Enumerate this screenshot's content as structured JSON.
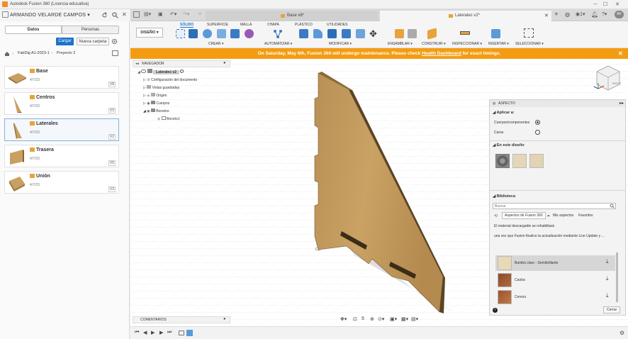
{
  "window": {
    "title": "Autodesk Fusion 360 (Licencia educativa)"
  },
  "left": {
    "user": "ARMANDO VELARDE CAMPOS",
    "tabs": [
      "Datos",
      "Personas"
    ],
    "buttons": {
      "upload": "Cargar",
      "new_folder": "Nueva carpeta"
    },
    "breadcrumb": [
      "FabDig A1-2023-1",
      "Proyecto 2"
    ],
    "files": [
      {
        "name": "Base",
        "date": "4/7/23",
        "version": "V8"
      },
      {
        "name": "Centros",
        "date": "4/7/23",
        "version": "V3"
      },
      {
        "name": "Laterales",
        "date": "4/7/23",
        "version": "V2"
      },
      {
        "name": "Trasera",
        "date": "4/7/23",
        "version": "V5"
      },
      {
        "name": "Unión",
        "date": "4/7/23",
        "version": "V3"
      }
    ]
  },
  "doc_tabs": [
    {
      "label": "Base v8*"
    },
    {
      "label": "Laterales v2*"
    }
  ],
  "toolbar": {
    "workspace": "DISEÑO",
    "tabs": [
      "SÓLIDO",
      "SUPERFICIE",
      "MALLA",
      "CHAPA",
      "PLÁSTICO",
      "UTILIDADES"
    ],
    "groups": [
      "CREAR",
      "AUTOMATIZAR",
      "MODIFICAR",
      "ENSAMBLAR",
      "CONSTRUIR",
      "INSPECCIONAR",
      "INSERTAR",
      "SELECCIONAR"
    ]
  },
  "banner": {
    "text_before": "On Saturday, May 6th, Fusion 360 will undergo maintenance. Please check",
    "link": "Health Dashboard",
    "text_after": "for exact timings."
  },
  "navigator": {
    "title": "NAVEGADOR",
    "root": "Laterales v2",
    "items": [
      "Configuración del documento",
      "Vistas guardadas",
      "Origen",
      "Cuerpos",
      "Bocetos",
      "Boceto1"
    ]
  },
  "comments": {
    "title": "COMENTARIOS"
  },
  "aspecto": {
    "title": "ASPECTO",
    "apply_label": "Aplicar a:",
    "option1": "Cuerpos/componentes",
    "option2": "Caras",
    "design_label": "En este diseño",
    "library_label": "Biblioteca",
    "search_placeholder": "Buscar",
    "lib_tabs": [
      "Aspectos de Fusion 360",
      "Mis aspectos",
      "Favoritos"
    ],
    "message1": "El material descargable se rehabilitará",
    "message2": "una vez que Fusion finalice la actualización mediante Live Update y ...",
    "materials": [
      "Bambú claro - Semibrillante",
      "Caoba",
      "Cerezo"
    ],
    "close_label": "Cerrar"
  },
  "viewcube": {
    "label": "RIGHT"
  },
  "colors": {
    "accent": "#1a73c8",
    "banner": "#f39c12",
    "wood": "#c8a264"
  }
}
